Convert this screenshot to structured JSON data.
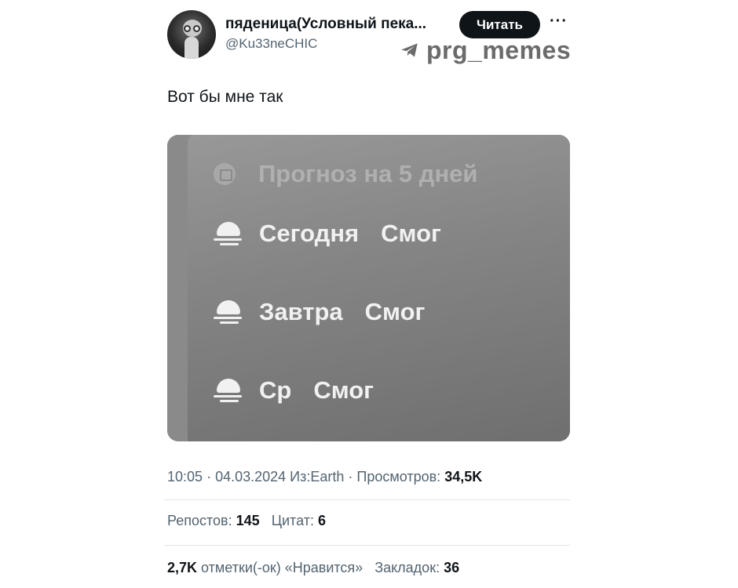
{
  "author": {
    "display_name": "пяденица(Условный пека...",
    "handle": "@Ku33neCHIC",
    "follow_label": "Читать",
    "more_label": "···"
  },
  "watermark": {
    "text": "prg_memes",
    "icon": "telegram-icon"
  },
  "tweet": {
    "text": "Вот бы мне так"
  },
  "card": {
    "title": "Прогноз на 5 дней",
    "rows": [
      {
        "day": "Сегодня",
        "condition": "Смог",
        "icon": "fog-icon"
      },
      {
        "day": "Завтра",
        "condition": "Смог",
        "icon": "fog-icon"
      },
      {
        "day": "Ср",
        "condition": "Смог",
        "icon": "fog-icon"
      }
    ]
  },
  "meta": {
    "time": "10:05",
    "date": "04.03.2024",
    "source": "Из:Earth",
    "views_label": "Просмотров:",
    "views_value": "34,5K"
  },
  "stats": {
    "reposts_label": "Репостов:",
    "reposts_value": "145",
    "quotes_label": "Цитат:",
    "quotes_value": "6",
    "likes_value": "2,7K",
    "likes_label": "отметки(-ок) «Нравится»",
    "bookmarks_label": "Закладок:",
    "bookmarks_value": "36"
  }
}
